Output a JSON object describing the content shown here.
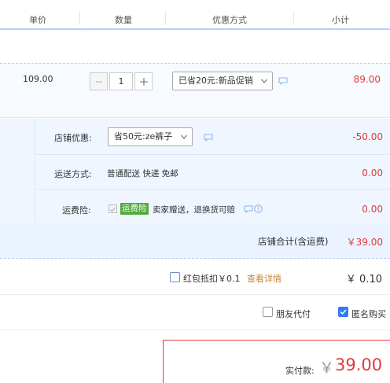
{
  "header": {
    "col_price": "单价",
    "col_qty": "数量",
    "col_promo": "优惠方式",
    "col_subtotal": "小计"
  },
  "item": {
    "unit_price": "109.00",
    "quantity": "1",
    "promo_selected": "已省20元:新品促销",
    "subtotal": "89.00"
  },
  "shop": {
    "discount_label": "店铺优惠:",
    "discount_selected": "省50元:ze裤子",
    "discount_value": "-50.00",
    "shipping_label": "运送方式:",
    "shipping_text": "普通配送 快递 免邮",
    "shipping_value": "0.00",
    "insurance_label": "运费险:",
    "insurance_tag": "运费险",
    "insurance_text": "卖家赠送，退换货可赔",
    "insurance_value": "0.00",
    "total_label": "店铺合计(含运费)",
    "total_value": "￥39.00"
  },
  "red_packet": {
    "label": "红包抵扣￥0.1",
    "details_link": "查看详情",
    "amount": "￥ 0.10"
  },
  "options": {
    "friend_pay": "朋友代付",
    "anonymous": "匿名购买"
  },
  "payment": {
    "label": "实付款:",
    "symbol": "￥",
    "amount": "39.00"
  },
  "colors": {
    "accent_red": "#e4393c",
    "link_orange": "#c8843a",
    "header_border": "#b2d1ff",
    "tag_green": "#52a83e"
  }
}
